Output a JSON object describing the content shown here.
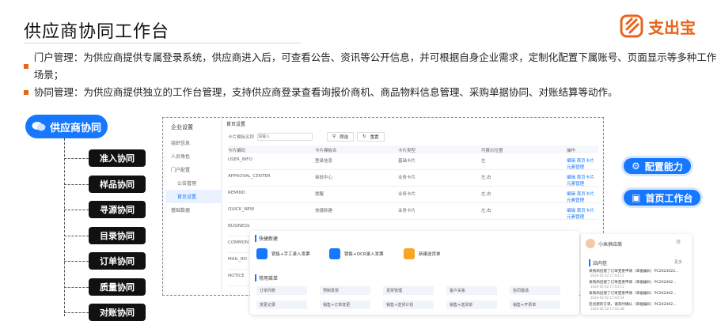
{
  "page": {
    "title": "供应商协同工作台"
  },
  "brand": {
    "name": "支出宝",
    "color": "#e8641b"
  },
  "bullets": [
    "门户管理：为供应商提供专属登录系统，供应商进入后，可查看公告、资讯等公开信息，并可根据自身企业需求，定制化配置下属账号、页面显示等多种工作场景；",
    "协同管理：为供应商提供独立的工作台管理，支持供应商登录查看询报价商机、商品物料信息管理、采购单据协同、对账结算等动作。"
  ],
  "tree": {
    "root": "供应商协同",
    "root_icon": "chat-bubbles-icon",
    "items": [
      "准入协同",
      "样品协同",
      "寻源协同",
      "目录协同",
      "订单协同",
      "质量协同",
      "对账协同"
    ]
  },
  "callouts": {
    "config": "配置能力",
    "home": "首页工作台"
  },
  "app": {
    "sidebar_title": "企业设置",
    "sidebar": [
      "组织信息",
      "人员角色",
      "门户配置",
      "公告管理",
      "首页设置",
      "基础数据"
    ],
    "breadcrumb": "首页设置",
    "filter_label": "卡片模板名称",
    "filter_placeholder": "请输入",
    "btn_search": "筛选",
    "btn_reset": "重置",
    "columns": [
      "卡片编码",
      "卡片模板名",
      "卡片类型",
      "可展示位置",
      "操作"
    ],
    "rows": [
      [
        "USER_INFO",
        "登录信息",
        "基础卡片",
        "左",
        "编辑  首页卡片"
      ],
      [
        "APPROVAL_CENTER",
        "审批中心",
        "业务卡片",
        "左,右",
        "编辑  首页卡片"
      ],
      [
        "REMIND",
        "提醒",
        "业务卡片",
        "左,右",
        "编辑  首页卡片"
      ],
      [
        "QUICK_NEW",
        "快捷新建",
        "业务卡片",
        "左,右",
        "编辑  首页卡片"
      ],
      [
        "BUSINESS",
        "",
        "",
        "",
        ""
      ],
      [
        "COMMON",
        "",
        "",
        "",
        ""
      ],
      [
        "MAIL_BO",
        "",
        "",
        "",
        ""
      ],
      [
        "NOTICE",
        "",
        "",
        "",
        ""
      ]
    ],
    "row_sub": "元素管理"
  },
  "quick": {
    "title": "快捷新建",
    "items": [
      "销售+手工录入发票",
      "销售+OCR录入发票",
      "新建送货单"
    ],
    "common_title": "常用菜单",
    "menus": [
      "订单列表",
      "预制发票",
      "发票管理",
      "客户关系",
      "协同邀请",
      "变更记录",
      "销售+订单变更",
      "销售+送货计划",
      "销售+送货单",
      "销售+开票单"
    ]
  },
  "profile": {
    "name": "小米供应商",
    "inbox_title": "站内信",
    "more": "更多",
    "messages": [
      {
        "text": "采购商创建了订单变更申请（单据编码：PC2024022...",
        "date": "2024-02-02 17:03:11"
      },
      {
        "text": "采购商创建了订单变更申请（单据编码：PC202402...",
        "date": "2024-02-02 17:03:11"
      },
      {
        "text": "采购商创建了订单变更申请（单据编码：PC202402...",
        "date": "2024-02-02 17:02:54"
      },
      {
        "text": "您创建的订单，请及时确认（单据编码：PC202402...",
        "date": "2024-02-02 17:01:48"
      }
    ]
  }
}
